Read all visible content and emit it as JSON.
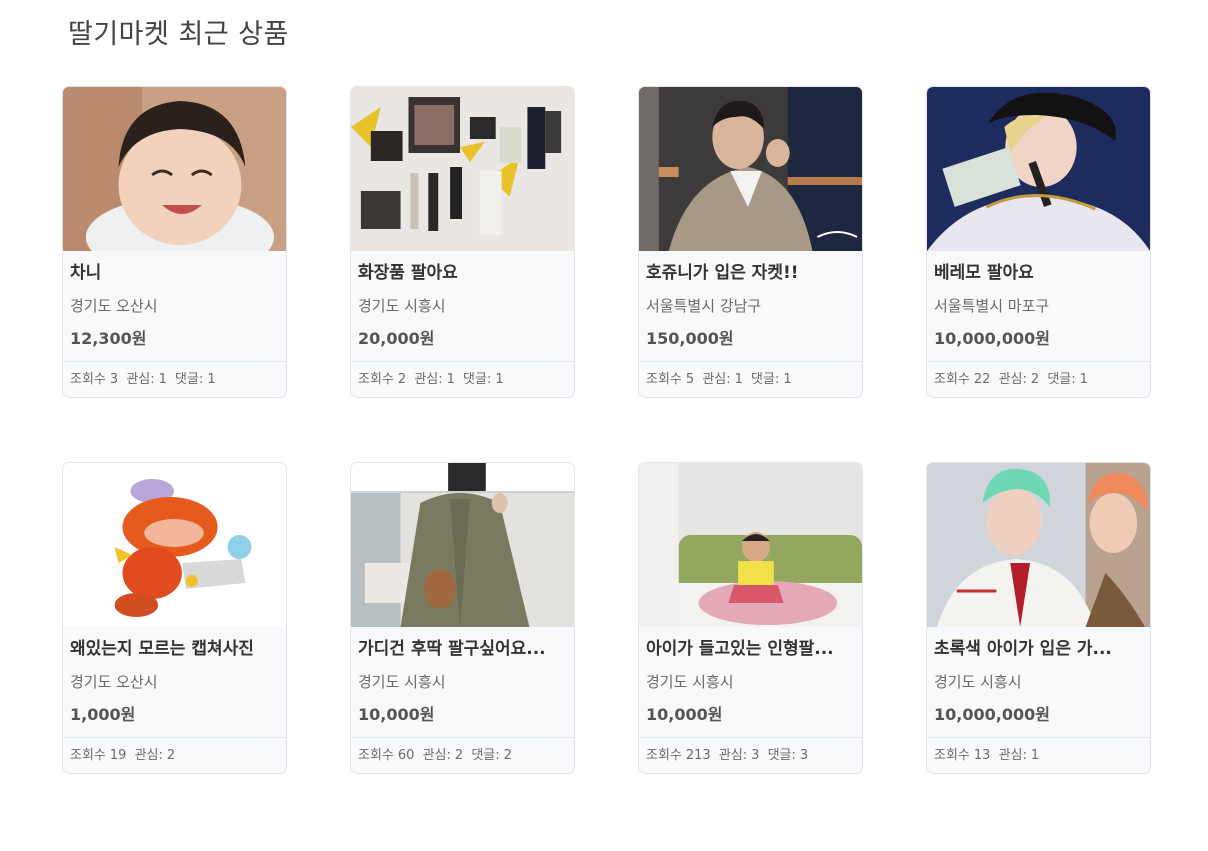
{
  "page": {
    "title": "딸기마켓 최근 상품"
  },
  "labels": {
    "views": "조회수",
    "likes": "관심:",
    "comments": "댓글:"
  },
  "products": [
    {
      "title": "차니",
      "region": "경기도 오산시",
      "price": "12,300원",
      "views": "3",
      "likes": "1",
      "comments": "1",
      "image": "child-smiling-photo"
    },
    {
      "title": "화장품 팔아요",
      "region": "경기도 시흥시",
      "price": "20,000원",
      "views": "2",
      "likes": "1",
      "comments": "1",
      "image": "cosmetics-photo"
    },
    {
      "title": "호쥬니가 입은 자켓!!",
      "region": "서울특별시 강남구",
      "price": "150,000원",
      "views": "5",
      "likes": "1",
      "comments": "1",
      "image": "singer-jacket-photo"
    },
    {
      "title": "베레모 팔아요",
      "region": "서울특별시 마포구",
      "price": "10,000,000원",
      "views": "22",
      "likes": "2",
      "comments": "1",
      "image": "beret-photo"
    },
    {
      "title": "왜있는지 모르는 캡쳐사진",
      "region": "경기도 오산시",
      "price": "1,000원",
      "views": "19",
      "likes": "2",
      "comments": null,
      "image": "game-character-image"
    },
    {
      "title": "가디건 후딱 팔구싶어요...",
      "region": "경기도 시흥시",
      "price": "10,000원",
      "views": "60",
      "likes": "2",
      "comments": "2",
      "image": "cardigan-photo"
    },
    {
      "title": "아이가 들고있는 인형팔...",
      "region": "경기도 시흥시",
      "price": "10,000원",
      "views": "213",
      "likes": "3",
      "comments": "3",
      "image": "kid-on-bed-photo"
    },
    {
      "title": "초록색 아이가 입은 가...",
      "region": "경기도 시흥시",
      "price": "10,000,000원",
      "views": "13",
      "likes": "1",
      "comments": null,
      "image": "green-hair-photo"
    }
  ]
}
